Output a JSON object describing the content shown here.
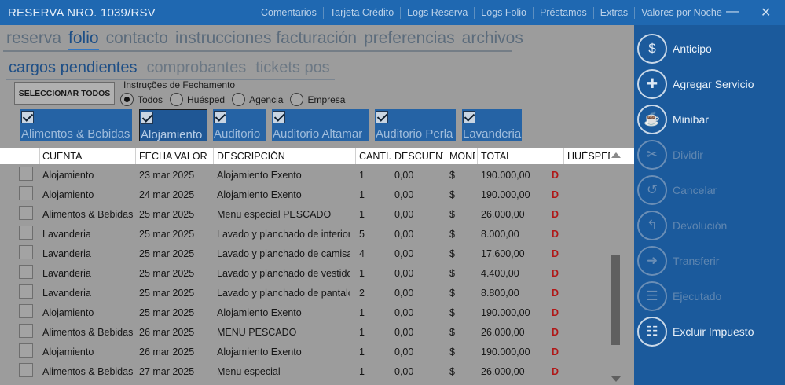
{
  "window": {
    "title": "RESERVA NRO. 1039/RSV",
    "menu": [
      "Comentarios",
      "Tarjeta Crédito",
      "Logs Reserva",
      "Logs Folio",
      "Préstamos",
      "Extras",
      "Valores por Noche"
    ],
    "minimize": "—",
    "close": "✕"
  },
  "tabs": [
    "reserva",
    "folio",
    "contacto",
    "instrucciones facturación",
    "preferencias",
    "archivos"
  ],
  "subtabs": [
    "cargos pendientes",
    "comprobantes",
    "tickets pos"
  ],
  "select_all": "SELECCIONAR TODOS",
  "instructions": {
    "label": "Instruções de Fechamento",
    "options": [
      "Todos",
      "Huésped",
      "Agencia",
      "Empresa"
    ]
  },
  "filters": [
    "Alimentos & Bebidas",
    "Alojamiento",
    "Auditorio",
    "Auditorio Altamar",
    "Auditorio Perla",
    "Lavanderia"
  ],
  "columns": [
    "CUENTA",
    "FECHA VALOR",
    "DESCRIPCIÓN",
    "CANTI.",
    "DESCUENTO",
    "MONEDA",
    "TOTAL",
    "HUÉSPED"
  ],
  "rows": [
    {
      "cuenta": "Alojamiento",
      "fecha": "23 mar 2025",
      "desc": "Alojamiento Exento",
      "cant": "1",
      "descuento": "0,00",
      "moneda": "$",
      "total": "190.000,00",
      "flag": "D"
    },
    {
      "cuenta": "Alojamiento",
      "fecha": "24 mar 2025",
      "desc": "Alojamiento Exento",
      "cant": "1",
      "descuento": "0,00",
      "moneda": "$",
      "total": "190.000,00",
      "flag": "D"
    },
    {
      "cuenta": "Alimentos & Bebidas",
      "fecha": "25 mar 2025",
      "desc": "Menu especial PESCADO",
      "cant": "1",
      "descuento": "0,00",
      "moneda": "$",
      "total": "26.000,00",
      "flag": "D"
    },
    {
      "cuenta": "Lavanderia",
      "fecha": "25 mar 2025",
      "desc": "Lavado y planchado de interiores",
      "cant": "5",
      "descuento": "0,00",
      "moneda": "$",
      "total": "8.000,00",
      "flag": "D"
    },
    {
      "cuenta": "Lavanderia",
      "fecha": "25 mar 2025",
      "desc": "Lavado y planchado de camisa",
      "cant": "4",
      "descuento": "0,00",
      "moneda": "$",
      "total": "17.600,00",
      "flag": "D"
    },
    {
      "cuenta": "Lavanderia",
      "fecha": "25 mar 2025",
      "desc": "Lavado y planchado de vestido de",
      "cant": "1",
      "descuento": "0,00",
      "moneda": "$",
      "total": "4.400,00",
      "flag": "D"
    },
    {
      "cuenta": "Lavanderia",
      "fecha": "25 mar 2025",
      "desc": "Lavado y planchado de pantalon",
      "cant": "2",
      "descuento": "0,00",
      "moneda": "$",
      "total": "8.800,00",
      "flag": "D"
    },
    {
      "cuenta": "Alojamiento",
      "fecha": "25 mar 2025",
      "desc": "Alojamiento Exento",
      "cant": "1",
      "descuento": "0,00",
      "moneda": "$",
      "total": "190.000,00",
      "flag": "D"
    },
    {
      "cuenta": "Alimentos & Bebidas",
      "fecha": "26 mar 2025",
      "desc": "MENU PESCADO",
      "cant": "1",
      "descuento": "0,00",
      "moneda": "$",
      "total": "26.000,00",
      "flag": "D"
    },
    {
      "cuenta": "Alojamiento",
      "fecha": "26 mar 2025",
      "desc": "Alojamiento Exento",
      "cant": "1",
      "descuento": "0,00",
      "moneda": "$",
      "total": "190.000,00",
      "flag": "D"
    },
    {
      "cuenta": "Alimentos & Bebidas",
      "fecha": "27 mar 2025",
      "desc": "Menu especial",
      "cant": "1",
      "descuento": "0,00",
      "moneda": "$",
      "total": "26.000,00",
      "flag": "D"
    }
  ],
  "actions": [
    {
      "label": "Anticipo",
      "icon": "money-icon",
      "glyph": "$"
    },
    {
      "label": "Agregar Servicio",
      "icon": "add-service-icon",
      "glyph": "✚"
    },
    {
      "label": "Minibar",
      "icon": "minibar-icon",
      "glyph": "☕"
    },
    {
      "label": "Dividir",
      "icon": "scissors-icon",
      "glyph": "✂"
    },
    {
      "label": "Cancelar",
      "icon": "undo-icon",
      "glyph": "↺"
    },
    {
      "label": "Devolución",
      "icon": "return-icon",
      "glyph": "↰"
    },
    {
      "label": "Transferir",
      "icon": "arrow-right-icon",
      "glyph": "➜"
    },
    {
      "label": "Ejecutado",
      "icon": "checklist-icon",
      "glyph": "☰"
    },
    {
      "label": "Excluir Impuesto",
      "icon": "exclude-tax-icon",
      "glyph": "☷"
    }
  ]
}
